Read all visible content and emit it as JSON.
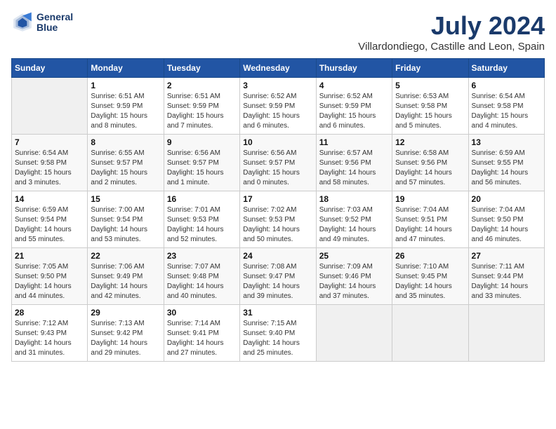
{
  "logo": {
    "line1": "General",
    "line2": "Blue"
  },
  "title": "July 2024",
  "subtitle": "Villardondiego, Castille and Leon, Spain",
  "days_of_week": [
    "Sunday",
    "Monday",
    "Tuesday",
    "Wednesday",
    "Thursday",
    "Friday",
    "Saturday"
  ],
  "weeks": [
    [
      {
        "day": "",
        "sunrise": "",
        "sunset": "",
        "daylight": ""
      },
      {
        "day": "1",
        "sunrise": "Sunrise: 6:51 AM",
        "sunset": "Sunset: 9:59 PM",
        "daylight": "Daylight: 15 hours and 8 minutes."
      },
      {
        "day": "2",
        "sunrise": "Sunrise: 6:51 AM",
        "sunset": "Sunset: 9:59 PM",
        "daylight": "Daylight: 15 hours and 7 minutes."
      },
      {
        "day": "3",
        "sunrise": "Sunrise: 6:52 AM",
        "sunset": "Sunset: 9:59 PM",
        "daylight": "Daylight: 15 hours and 6 minutes."
      },
      {
        "day": "4",
        "sunrise": "Sunrise: 6:52 AM",
        "sunset": "Sunset: 9:59 PM",
        "daylight": "Daylight: 15 hours and 6 minutes."
      },
      {
        "day": "5",
        "sunrise": "Sunrise: 6:53 AM",
        "sunset": "Sunset: 9:58 PM",
        "daylight": "Daylight: 15 hours and 5 minutes."
      },
      {
        "day": "6",
        "sunrise": "Sunrise: 6:54 AM",
        "sunset": "Sunset: 9:58 PM",
        "daylight": "Daylight: 15 hours and 4 minutes."
      }
    ],
    [
      {
        "day": "7",
        "sunrise": "Sunrise: 6:54 AM",
        "sunset": "Sunset: 9:58 PM",
        "daylight": "Daylight: 15 hours and 3 minutes."
      },
      {
        "day": "8",
        "sunrise": "Sunrise: 6:55 AM",
        "sunset": "Sunset: 9:57 PM",
        "daylight": "Daylight: 15 hours and 2 minutes."
      },
      {
        "day": "9",
        "sunrise": "Sunrise: 6:56 AM",
        "sunset": "Sunset: 9:57 PM",
        "daylight": "Daylight: 15 hours and 1 minute."
      },
      {
        "day": "10",
        "sunrise": "Sunrise: 6:56 AM",
        "sunset": "Sunset: 9:57 PM",
        "daylight": "Daylight: 15 hours and 0 minutes."
      },
      {
        "day": "11",
        "sunrise": "Sunrise: 6:57 AM",
        "sunset": "Sunset: 9:56 PM",
        "daylight": "Daylight: 14 hours and 58 minutes."
      },
      {
        "day": "12",
        "sunrise": "Sunrise: 6:58 AM",
        "sunset": "Sunset: 9:56 PM",
        "daylight": "Daylight: 14 hours and 57 minutes."
      },
      {
        "day": "13",
        "sunrise": "Sunrise: 6:59 AM",
        "sunset": "Sunset: 9:55 PM",
        "daylight": "Daylight: 14 hours and 56 minutes."
      }
    ],
    [
      {
        "day": "14",
        "sunrise": "Sunrise: 6:59 AM",
        "sunset": "Sunset: 9:54 PM",
        "daylight": "Daylight: 14 hours and 55 minutes."
      },
      {
        "day": "15",
        "sunrise": "Sunrise: 7:00 AM",
        "sunset": "Sunset: 9:54 PM",
        "daylight": "Daylight: 14 hours and 53 minutes."
      },
      {
        "day": "16",
        "sunrise": "Sunrise: 7:01 AM",
        "sunset": "Sunset: 9:53 PM",
        "daylight": "Daylight: 14 hours and 52 minutes."
      },
      {
        "day": "17",
        "sunrise": "Sunrise: 7:02 AM",
        "sunset": "Sunset: 9:53 PM",
        "daylight": "Daylight: 14 hours and 50 minutes."
      },
      {
        "day": "18",
        "sunrise": "Sunrise: 7:03 AM",
        "sunset": "Sunset: 9:52 PM",
        "daylight": "Daylight: 14 hours and 49 minutes."
      },
      {
        "day": "19",
        "sunrise": "Sunrise: 7:04 AM",
        "sunset": "Sunset: 9:51 PM",
        "daylight": "Daylight: 14 hours and 47 minutes."
      },
      {
        "day": "20",
        "sunrise": "Sunrise: 7:04 AM",
        "sunset": "Sunset: 9:50 PM",
        "daylight": "Daylight: 14 hours and 46 minutes."
      }
    ],
    [
      {
        "day": "21",
        "sunrise": "Sunrise: 7:05 AM",
        "sunset": "Sunset: 9:50 PM",
        "daylight": "Daylight: 14 hours and 44 minutes."
      },
      {
        "day": "22",
        "sunrise": "Sunrise: 7:06 AM",
        "sunset": "Sunset: 9:49 PM",
        "daylight": "Daylight: 14 hours and 42 minutes."
      },
      {
        "day": "23",
        "sunrise": "Sunrise: 7:07 AM",
        "sunset": "Sunset: 9:48 PM",
        "daylight": "Daylight: 14 hours and 40 minutes."
      },
      {
        "day": "24",
        "sunrise": "Sunrise: 7:08 AM",
        "sunset": "Sunset: 9:47 PM",
        "daylight": "Daylight: 14 hours and 39 minutes."
      },
      {
        "day": "25",
        "sunrise": "Sunrise: 7:09 AM",
        "sunset": "Sunset: 9:46 PM",
        "daylight": "Daylight: 14 hours and 37 minutes."
      },
      {
        "day": "26",
        "sunrise": "Sunrise: 7:10 AM",
        "sunset": "Sunset: 9:45 PM",
        "daylight": "Daylight: 14 hours and 35 minutes."
      },
      {
        "day": "27",
        "sunrise": "Sunrise: 7:11 AM",
        "sunset": "Sunset: 9:44 PM",
        "daylight": "Daylight: 14 hours and 33 minutes."
      }
    ],
    [
      {
        "day": "28",
        "sunrise": "Sunrise: 7:12 AM",
        "sunset": "Sunset: 9:43 PM",
        "daylight": "Daylight: 14 hours and 31 minutes."
      },
      {
        "day": "29",
        "sunrise": "Sunrise: 7:13 AM",
        "sunset": "Sunset: 9:42 PM",
        "daylight": "Daylight: 14 hours and 29 minutes."
      },
      {
        "day": "30",
        "sunrise": "Sunrise: 7:14 AM",
        "sunset": "Sunset: 9:41 PM",
        "daylight": "Daylight: 14 hours and 27 minutes."
      },
      {
        "day": "31",
        "sunrise": "Sunrise: 7:15 AM",
        "sunset": "Sunset: 9:40 PM",
        "daylight": "Daylight: 14 hours and 25 minutes."
      },
      {
        "day": "",
        "sunrise": "",
        "sunset": "",
        "daylight": ""
      },
      {
        "day": "",
        "sunrise": "",
        "sunset": "",
        "daylight": ""
      },
      {
        "day": "",
        "sunrise": "",
        "sunset": "",
        "daylight": ""
      }
    ]
  ]
}
